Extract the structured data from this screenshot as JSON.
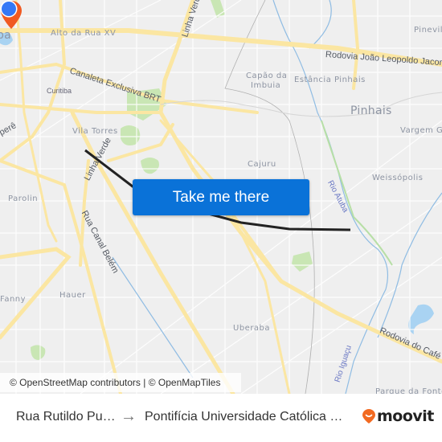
{
  "map": {
    "labels": {
      "alto_da_rua_xv": "Alto da Rua XV",
      "canaleta": "Canaleta Exclusiva BRT",
      "curitiba": "Curitiba",
      "linha_verde_top": "Linha Verde",
      "linha_verde_mid": "Linha Verde",
      "rodovia_joao": "Rodovia João Leopoldo Jacomel",
      "capao_da_imbuia_1": "Capão da",
      "capao_da_imbuia_2": "Imbuia",
      "estancia_pinhais": "Estância Pinhais",
      "pinhais": "Pinhais",
      "pineville": "Pineville",
      "vargem_grande": "Vargem Grande",
      "weissopolis": "Weissópolis",
      "rio_atuba": "Rio Atuba",
      "cajuru": "Cajuru",
      "vila_torres": "Vila Torres",
      "ba": "ba",
      "boqueirao_frag": "perê",
      "parolin": "Parolin",
      "rua_canal_belem": "Rua Canal Belém",
      "fanny": "Fanny",
      "hauer": "Hauer",
      "uberaba": "Uberaba",
      "rio_iguacu": "Rio Iguaçu",
      "rodovia_do_cafe": "Rodovia do Café",
      "parque_da_fonte": "Parque da Fonte"
    },
    "route": {
      "color": "#222222",
      "origin_color": "#3478f6",
      "destination_color": "#f05a22"
    },
    "attribution": "© OpenStreetMap contributors | © OpenMapTiles"
  },
  "cta": {
    "label": "Take me there",
    "color": "#0a72d8"
  },
  "footer": {
    "origin": "Rua Rutildo Pu…",
    "arrow": "→",
    "destination": "Pontifícia Universidade Católica …",
    "brand": "moovit",
    "brand_color": "#f26a21"
  }
}
